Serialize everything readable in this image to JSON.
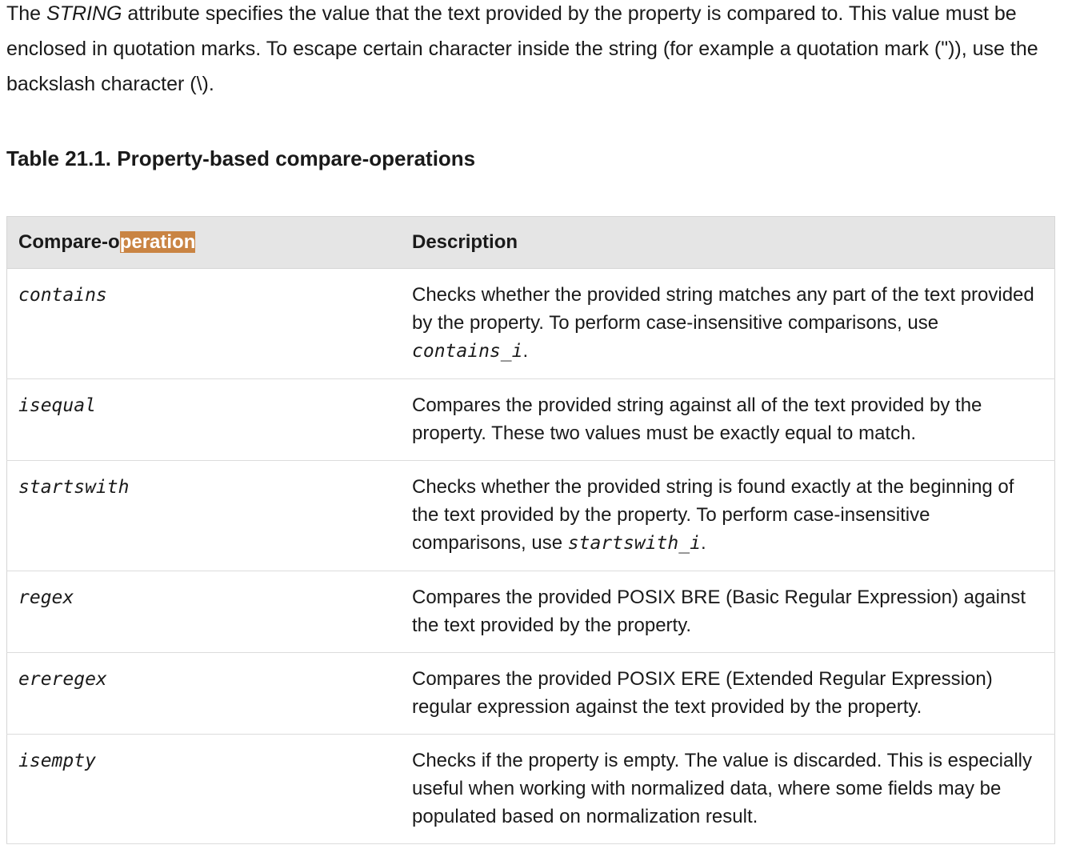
{
  "intro": {
    "before": "The ",
    "emph": "STRING",
    "after": " attribute specifies the value that the text provided by the property is compared to. This value must be enclosed in quotation marks. To escape certain character inside the string (for example a quotation mark (\")), use the backslash character (\\)."
  },
  "table": {
    "title": "Table 21.1. Property-based compare-operations",
    "headers": {
      "op_plain": "Compare-o",
      "op_highlighted": "peration",
      "description": "Description"
    },
    "rows": [
      {
        "op": "contains",
        "desc_before": "Checks whether the provided string matches any part of the text provided by the property. To perform case-insensitive comparisons, use ",
        "desc_code": "contains_i",
        "desc_after": "."
      },
      {
        "op": "isequal",
        "desc_before": "Compares the provided string against all of the text provided by the property. These two values must be exactly equal to match.",
        "desc_code": "",
        "desc_after": ""
      },
      {
        "op": "startswith",
        "desc_before": "Checks whether the provided string is found exactly at the beginning of the text provided by the property. To perform case-insensitive comparisons, use ",
        "desc_code": "startswith_i",
        "desc_after": "."
      },
      {
        "op": "regex",
        "desc_before": "Compares the provided POSIX BRE (Basic Regular Expression) against the text provided by the property.",
        "desc_code": "",
        "desc_after": ""
      },
      {
        "op": "ereregex",
        "desc_before": "Compares the provided POSIX ERE (Extended Regular Expression) regular expression against the text provided by the property.",
        "desc_code": "",
        "desc_after": ""
      },
      {
        "op": "isempty",
        "desc_before": "Checks if the property is empty. The value is discarded. This is especially useful when working with normalized data, where some fields may be populated based on normalization result.",
        "desc_code": "",
        "desc_after": ""
      }
    ]
  },
  "colors": {
    "highlight": "#c98443",
    "header_bg": "#e5e5e5"
  }
}
